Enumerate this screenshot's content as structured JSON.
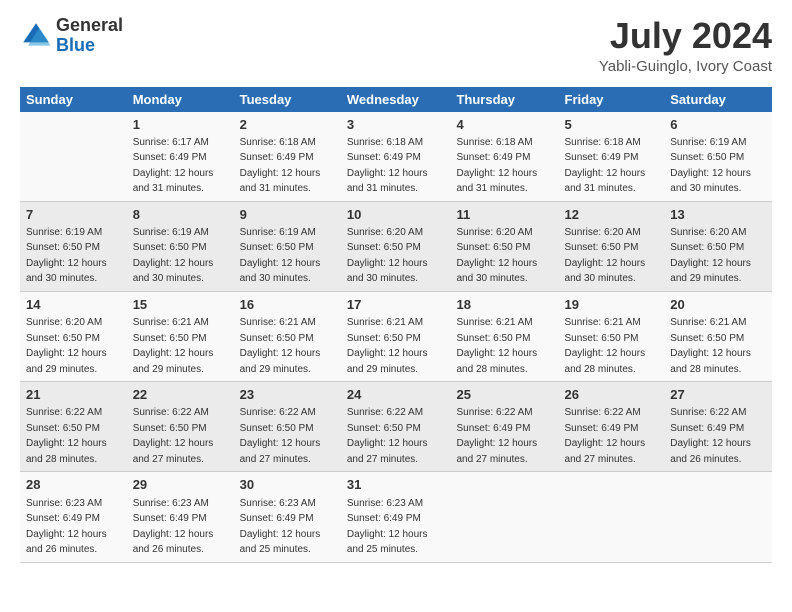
{
  "header": {
    "logo_general": "General",
    "logo_blue": "Blue",
    "month_year": "July 2024",
    "location": "Yabli-Guinglo, Ivory Coast"
  },
  "weekdays": [
    "Sunday",
    "Monday",
    "Tuesday",
    "Wednesday",
    "Thursday",
    "Friday",
    "Saturday"
  ],
  "weeks": [
    [
      null,
      {
        "day": "1",
        "sunrise": "6:17 AM",
        "sunset": "6:49 PM",
        "daylight": "12 hours and 31 minutes."
      },
      {
        "day": "2",
        "sunrise": "6:18 AM",
        "sunset": "6:49 PM",
        "daylight": "12 hours and 31 minutes."
      },
      {
        "day": "3",
        "sunrise": "6:18 AM",
        "sunset": "6:49 PM",
        "daylight": "12 hours and 31 minutes."
      },
      {
        "day": "4",
        "sunrise": "6:18 AM",
        "sunset": "6:49 PM",
        "daylight": "12 hours and 31 minutes."
      },
      {
        "day": "5",
        "sunrise": "6:18 AM",
        "sunset": "6:49 PM",
        "daylight": "12 hours and 31 minutes."
      },
      {
        "day": "6",
        "sunrise": "6:19 AM",
        "sunset": "6:50 PM",
        "daylight": "12 hours and 30 minutes."
      }
    ],
    [
      {
        "day": "7",
        "sunrise": "6:19 AM",
        "sunset": "6:50 PM",
        "daylight": "12 hours and 30 minutes."
      },
      {
        "day": "8",
        "sunrise": "6:19 AM",
        "sunset": "6:50 PM",
        "daylight": "12 hours and 30 minutes."
      },
      {
        "day": "9",
        "sunrise": "6:19 AM",
        "sunset": "6:50 PM",
        "daylight": "12 hours and 30 minutes."
      },
      {
        "day": "10",
        "sunrise": "6:20 AM",
        "sunset": "6:50 PM",
        "daylight": "12 hours and 30 minutes."
      },
      {
        "day": "11",
        "sunrise": "6:20 AM",
        "sunset": "6:50 PM",
        "daylight": "12 hours and 30 minutes."
      },
      {
        "day": "12",
        "sunrise": "6:20 AM",
        "sunset": "6:50 PM",
        "daylight": "12 hours and 30 minutes."
      },
      {
        "day": "13",
        "sunrise": "6:20 AM",
        "sunset": "6:50 PM",
        "daylight": "12 hours and 29 minutes."
      }
    ],
    [
      {
        "day": "14",
        "sunrise": "6:20 AM",
        "sunset": "6:50 PM",
        "daylight": "12 hours and 29 minutes."
      },
      {
        "day": "15",
        "sunrise": "6:21 AM",
        "sunset": "6:50 PM",
        "daylight": "12 hours and 29 minutes."
      },
      {
        "day": "16",
        "sunrise": "6:21 AM",
        "sunset": "6:50 PM",
        "daylight": "12 hours and 29 minutes."
      },
      {
        "day": "17",
        "sunrise": "6:21 AM",
        "sunset": "6:50 PM",
        "daylight": "12 hours and 29 minutes."
      },
      {
        "day": "18",
        "sunrise": "6:21 AM",
        "sunset": "6:50 PM",
        "daylight": "12 hours and 28 minutes."
      },
      {
        "day": "19",
        "sunrise": "6:21 AM",
        "sunset": "6:50 PM",
        "daylight": "12 hours and 28 minutes."
      },
      {
        "day": "20",
        "sunrise": "6:21 AM",
        "sunset": "6:50 PM",
        "daylight": "12 hours and 28 minutes."
      }
    ],
    [
      {
        "day": "21",
        "sunrise": "6:22 AM",
        "sunset": "6:50 PM",
        "daylight": "12 hours and 28 minutes."
      },
      {
        "day": "22",
        "sunrise": "6:22 AM",
        "sunset": "6:50 PM",
        "daylight": "12 hours and 27 minutes."
      },
      {
        "day": "23",
        "sunrise": "6:22 AM",
        "sunset": "6:50 PM",
        "daylight": "12 hours and 27 minutes."
      },
      {
        "day": "24",
        "sunrise": "6:22 AM",
        "sunset": "6:50 PM",
        "daylight": "12 hours and 27 minutes."
      },
      {
        "day": "25",
        "sunrise": "6:22 AM",
        "sunset": "6:49 PM",
        "daylight": "12 hours and 27 minutes."
      },
      {
        "day": "26",
        "sunrise": "6:22 AM",
        "sunset": "6:49 PM",
        "daylight": "12 hours and 27 minutes."
      },
      {
        "day": "27",
        "sunrise": "6:22 AM",
        "sunset": "6:49 PM",
        "daylight": "12 hours and 26 minutes."
      }
    ],
    [
      {
        "day": "28",
        "sunrise": "6:23 AM",
        "sunset": "6:49 PM",
        "daylight": "12 hours and 26 minutes."
      },
      {
        "day": "29",
        "sunrise": "6:23 AM",
        "sunset": "6:49 PM",
        "daylight": "12 hours and 26 minutes."
      },
      {
        "day": "30",
        "sunrise": "6:23 AM",
        "sunset": "6:49 PM",
        "daylight": "12 hours and 25 minutes."
      },
      {
        "day": "31",
        "sunrise": "6:23 AM",
        "sunset": "6:49 PM",
        "daylight": "12 hours and 25 minutes."
      },
      null,
      null,
      null
    ]
  ]
}
